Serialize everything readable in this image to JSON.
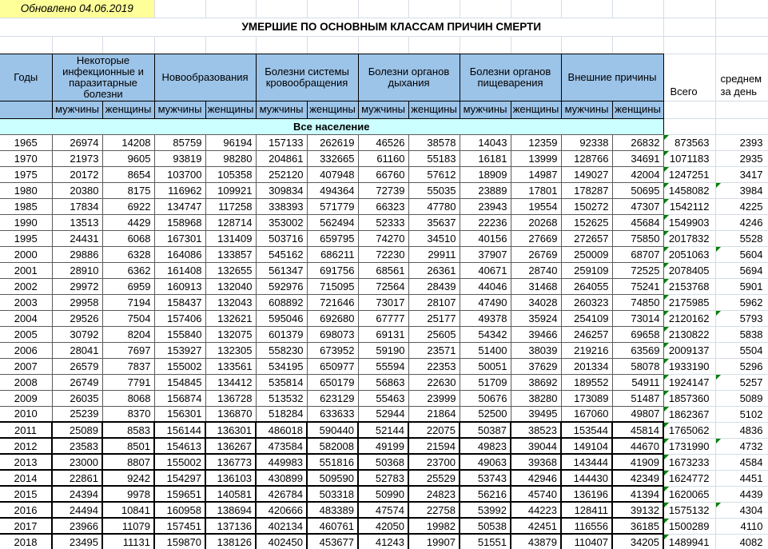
{
  "meta": {
    "updated_note": "Обновлено 04.06.2019",
    "title": "УМЕРШИЕ ПО ОСНОВНЫМ КЛАССАМ ПРИЧИН СМЕРТИ"
  },
  "columns": {
    "years": "Годы",
    "groups": [
      "Некоторые инфекционные и паразитарные болезни",
      "Новообразования",
      "Болезни системы кровообращения",
      "Болезни органов дыхания",
      "Болезни органов пищеварения",
      "Внешние причины"
    ],
    "male": "мужчины",
    "female": "женщины",
    "total": "Всего",
    "avg_per_day": "среднем за день"
  },
  "section": "Все население",
  "colors": {
    "header_fill": "#9CC3E8",
    "section_fill": "#CCFFFF",
    "note_fill": "#FFFF99",
    "error_indicator": "#008000",
    "gridline": "#D5DCE6"
  },
  "row_columns": [
    "year",
    "infectious_m",
    "infectious_f",
    "neoplasms_m",
    "neoplasms_f",
    "circulatory_m",
    "circulatory_f",
    "respiratory_m",
    "respiratory_f",
    "digestive_m",
    "digestive_f",
    "external_m",
    "external_f",
    "total",
    "avg_per_day"
  ],
  "table": {
    "rows": [
      [
        1965,
        26974,
        14208,
        85759,
        96194,
        157133,
        262619,
        46526,
        38578,
        14043,
        12359,
        92338,
        26832,
        873563,
        2393
      ],
      [
        1970,
        21973,
        9605,
        93819,
        98280,
        204861,
        332665,
        61160,
        55183,
        16181,
        13999,
        128766,
        34691,
        1071183,
        2935
      ],
      [
        1975,
        20172,
        8654,
        103700,
        105358,
        252120,
        407948,
        66760,
        57612,
        18909,
        14987,
        149027,
        42004,
        1247251,
        3417
      ],
      [
        1980,
        20380,
        8175,
        116962,
        109921,
        309834,
        494364,
        72739,
        55035,
        23889,
        17801,
        178287,
        50695,
        1458082,
        3984
      ],
      [
        1985,
        17834,
        6922,
        134747,
        117258,
        338393,
        571779,
        66323,
        47780,
        23943,
        19554,
        150272,
        47307,
        1542112,
        4225
      ],
      [
        1990,
        13513,
        4429,
        158968,
        128714,
        353002,
        562494,
        52333,
        35637,
        22236,
        20268,
        152625,
        45684,
        1549903,
        4246
      ],
      [
        1995,
        24431,
        6068,
        167301,
        131409,
        503716,
        659795,
        74270,
        34510,
        40156,
        27669,
        272657,
        75850,
        2017832,
        5528
      ],
      [
        2000,
        29886,
        6328,
        164086,
        133857,
        545162,
        686211,
        72230,
        29911,
        37907,
        26769,
        250009,
        68707,
        2051063,
        5604
      ],
      [
        2001,
        28910,
        6362,
        161408,
        132655,
        561347,
        691756,
        68561,
        26361,
        40671,
        28740,
        259109,
        72525,
        2078405,
        5694
      ],
      [
        2002,
        29972,
        6959,
        160913,
        132040,
        592976,
        715095,
        72564,
        28439,
        44046,
        31468,
        264055,
        75241,
        2153768,
        5901
      ],
      [
        2003,
        29958,
        7194,
        158437,
        132043,
        608892,
        721646,
        73017,
        28107,
        47490,
        34028,
        260323,
        74850,
        2175985,
        5962
      ],
      [
        2004,
        29526,
        7504,
        157406,
        132621,
        595046,
        692680,
        67777,
        25177,
        49378,
        35924,
        254109,
        73014,
        2120162,
        5793
      ],
      [
        2005,
        30792,
        8204,
        155840,
        132075,
        601379,
        698073,
        69131,
        25605,
        54342,
        39466,
        246257,
        69658,
        2130822,
        5838
      ],
      [
        2006,
        28041,
        7697,
        153927,
        132305,
        558230,
        673952,
        59190,
        23571,
        51400,
        38039,
        219216,
        63569,
        2009137,
        5504
      ],
      [
        2007,
        26579,
        7837,
        155002,
        133561,
        534195,
        650977,
        55594,
        22353,
        50051,
        37629,
        201334,
        58078,
        1933190,
        5296
      ],
      [
        2008,
        26749,
        7791,
        154845,
        134412,
        535814,
        650179,
        56863,
        22630,
        51709,
        38692,
        189552,
        54911,
        1924147,
        5257
      ],
      [
        2009,
        26035,
        8068,
        156874,
        136728,
        513532,
        623129,
        55463,
        23999,
        50676,
        38280,
        173089,
        51487,
        1857360,
        5089
      ],
      [
        2010,
        25239,
        8370,
        156301,
        136870,
        518284,
        633633,
        52944,
        21864,
        52500,
        39495,
        167060,
        49807,
        1862367,
        5102
      ],
      [
        2011,
        25089,
        8583,
        156144,
        136301,
        486018,
        590440,
        52144,
        22075,
        50387,
        38523,
        153544,
        45814,
        1765062,
        4836
      ],
      [
        2012,
        23583,
        8501,
        154613,
        136267,
        473584,
        582008,
        49199,
        21594,
        49823,
        39044,
        149104,
        44670,
        1731990,
        4732
      ],
      [
        2013,
        23000,
        8807,
        155002,
        136773,
        449983,
        551816,
        50368,
        23700,
        49063,
        39368,
        143444,
        41909,
        1673233,
        4584
      ],
      [
        2014,
        22861,
        9242,
        154297,
        136103,
        430899,
        509590,
        52783,
        25529,
        53743,
        42946,
        144430,
        42349,
        1624772,
        4451
      ],
      [
        2015,
        24394,
        9978,
        159651,
        140581,
        426784,
        503318,
        50990,
        24823,
        56216,
        45740,
        136196,
        41394,
        1620065,
        4439
      ],
      [
        2016,
        24494,
        10841,
        160958,
        138694,
        420666,
        483389,
        47574,
        22758,
        53992,
        44223,
        128411,
        39132,
        1575132,
        4304
      ],
      [
        2017,
        23966,
        11079,
        157451,
        137136,
        402134,
        460761,
        42050,
        19982,
        50538,
        42451,
        116556,
        36185,
        1500289,
        4110
      ],
      [
        2018,
        23495,
        11131,
        159870,
        138126,
        402450,
        453677,
        41243,
        19907,
        51551,
        43879,
        110407,
        34205,
        1489941,
        4082
      ]
    ]
  }
}
